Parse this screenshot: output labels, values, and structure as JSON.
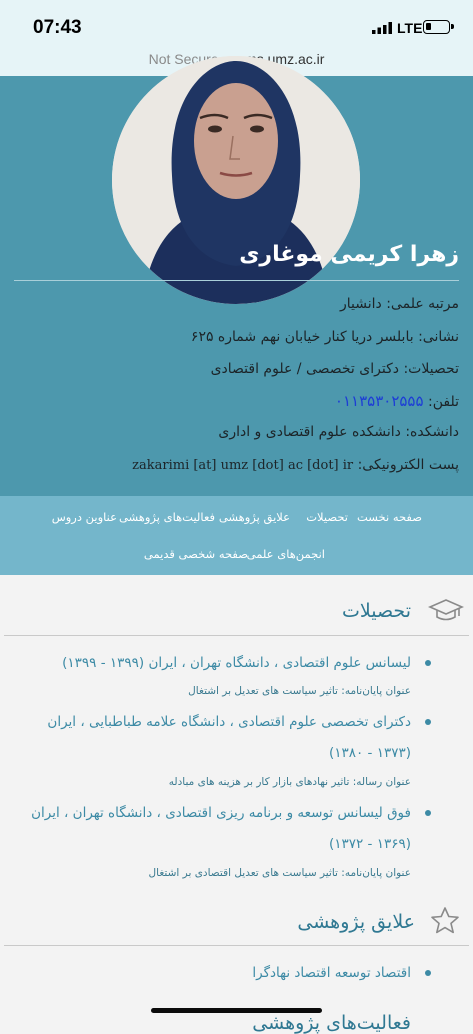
{
  "status_bar": {
    "time": "07:43",
    "network": "LTE"
  },
  "url_bar": {
    "security": "Not Secure",
    "separator": " — ",
    "domain": "rms.umz.ac.ir"
  },
  "profile": {
    "name": "زهرا کریمی موغاری",
    "rank_label": "مرتبه علمی:",
    "rank": "دانشیار",
    "address_label": "نشانی:",
    "address": "بابلسر دریا کنار خیابان نهم شماره ۶۲۵",
    "education_label": "تحصیلات:",
    "education": "دکترای تخصصی / علوم اقتصادی",
    "phone_label": "تلفن:",
    "phone": "۰۱۱۳۵۳۰۲۵۵۵",
    "faculty_label": "دانشکده:",
    "faculty": "دانشکده علوم اقتصادی و اداری",
    "email_label": "پست الکترونیکی:",
    "email": "zakarimi [at] umz [dot] ac [dot] ir"
  },
  "nav": {
    "items": [
      "صفحه نخست",
      "تحصیلات",
      "علایق پژوهشی",
      "فعالیت‌های پژوهشی",
      "عناوین دروس",
      "انجمن‌های علمی",
      "صفحه شخصی قدیمی"
    ]
  },
  "education_section": {
    "title": "تحصیلات",
    "entries": [
      {
        "line1": "لیسانس علوم اقتصادی ، دانشگاه تهران ، ایران (۱۳۹۹ - ۱۳۹۹)",
        "line2": "",
        "sub": "عنوان پایان‌نامه: تاثیر سیاست های تعدیل بر اشتغال"
      },
      {
        "line1": "دکترای تخصصی علوم اقتصادی ، دانشگاه علامه طباطبایی ، ایران",
        "line2": "(۱۳۷۳ - ۱۳۸۰)",
        "sub": "عنوان رساله: تاثیر نهادهای بازار کار بر هزینه های مبادله"
      },
      {
        "line1": "فوق لیسانس توسعه و برنامه ریزی اقتصادی ، دانشگاه تهران ، ایران",
        "line2": "(۱۳۶۹ - ۱۳۷۲)",
        "sub": "عنوان پایان‌نامه: تاثیر سیاست های تعدیل اقتصادی بر اشتغال"
      }
    ]
  },
  "research_section": {
    "title": "علایق پژوهشی",
    "entries": [
      "اقتصاد توسعه اقتصاد نهادگرا"
    ]
  },
  "activities_section": {
    "title": "فعالیت‌های پژوهشی"
  },
  "icons": {
    "education": "graduation-cap-icon",
    "research": "star-icon"
  }
}
